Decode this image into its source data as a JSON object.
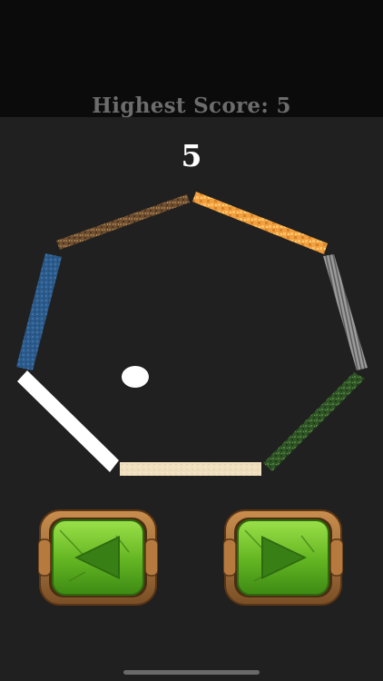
{
  "header": {
    "highest_score_label": "Highest Score: 5"
  },
  "game": {
    "score": "5"
  },
  "controls": {
    "left_icon": "triangle-left-icon",
    "right_icon": "triangle-right-icon"
  },
  "colors": {
    "background": "#202020",
    "top_band": "#0b0b0b",
    "wall_brown": "#7a5a3a",
    "wall_orange": "#f0a040",
    "wall_gray": "#8a8a8a",
    "wall_green": "#3d6a2d",
    "wall_cream": "#f0dfbf",
    "wall_white": "#ffffff",
    "wall_blue": "#2d5b8c",
    "button_green": "#6bbf2a",
    "button_frame": "#9a6a3a"
  }
}
